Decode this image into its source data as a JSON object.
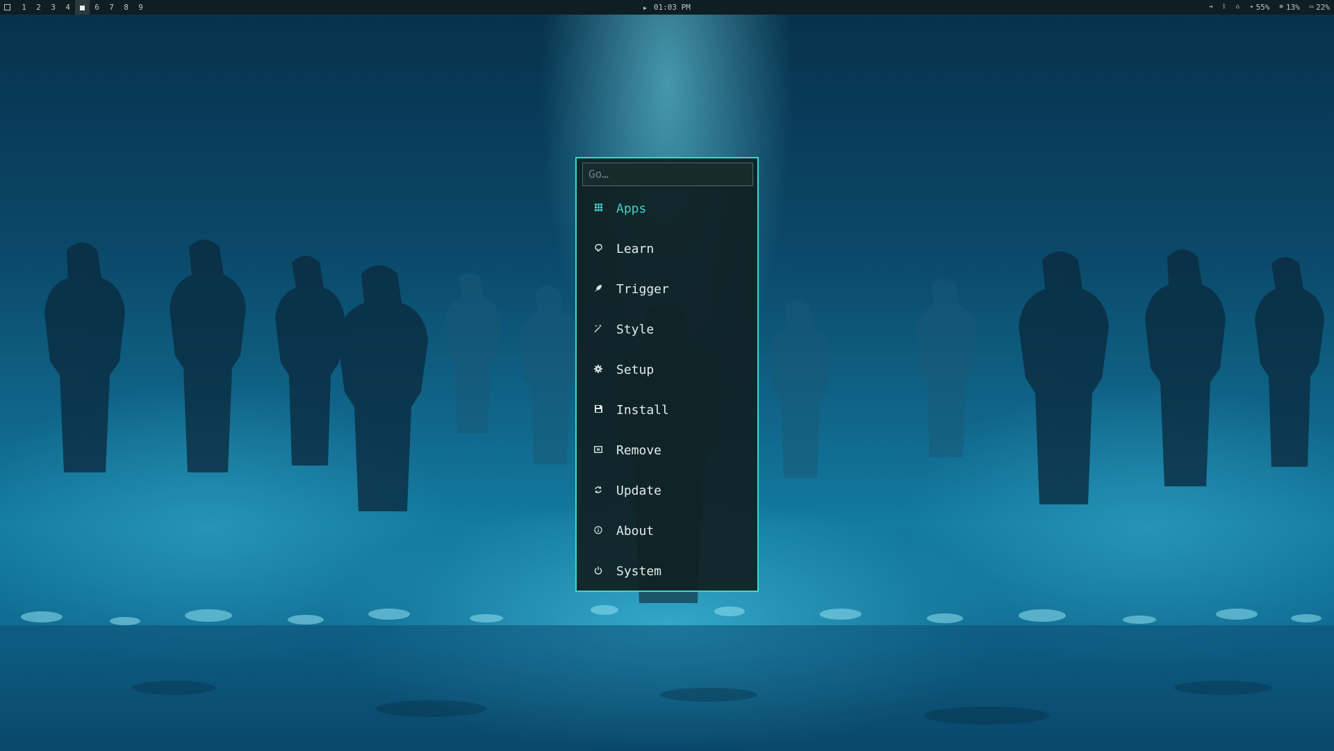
{
  "topbar": {
    "workspaces": [
      "1",
      "2",
      "3",
      "4",
      "",
      "6",
      "7",
      "8",
      "9"
    ],
    "active_workspace": "5",
    "clock": "01:03 PM",
    "tray": {
      "volume": "55%",
      "cpu": "13%",
      "battery": "22%"
    }
  },
  "launcher": {
    "search_placeholder": "Go…",
    "items": [
      {
        "label": "Apps",
        "icon": "grid-icon"
      },
      {
        "label": "Learn",
        "icon": "brain-icon"
      },
      {
        "label": "Trigger",
        "icon": "rocket-icon"
      },
      {
        "label": "Style",
        "icon": "magic-wand-icon"
      },
      {
        "label": "Setup",
        "icon": "gear-icon"
      },
      {
        "label": "Install",
        "icon": "floppy-disk-icon"
      },
      {
        "label": "Remove",
        "icon": "remove-box-icon"
      },
      {
        "label": "Update",
        "icon": "refresh-icon"
      },
      {
        "label": "About",
        "icon": "info-icon"
      },
      {
        "label": "System",
        "icon": "power-icon"
      }
    ],
    "selected_item": "Apps"
  },
  "colors": {
    "accent": "#3fd6cc",
    "bar_background": "#0f1e22",
    "launcher_background": "#102022"
  }
}
